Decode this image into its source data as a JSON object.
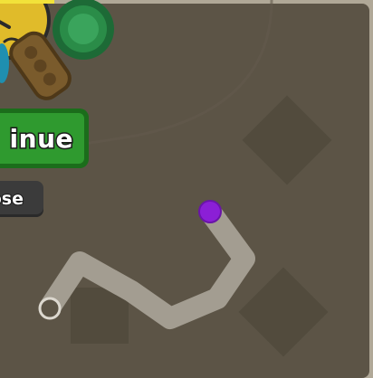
{
  "buttons": {
    "continue_label": "inue",
    "close_label": "ose"
  },
  "colors": {
    "board": "#5c5446",
    "trail": "#a39d91",
    "player": "#8b1fd6",
    "continue_green": "#2f9a2f",
    "clover": "#2a8c48",
    "face": "#e0bb2a"
  },
  "icons": {
    "face": "angry-face-icon",
    "clover": "clover-petal-icon",
    "mob": "peas-pod-icon"
  }
}
